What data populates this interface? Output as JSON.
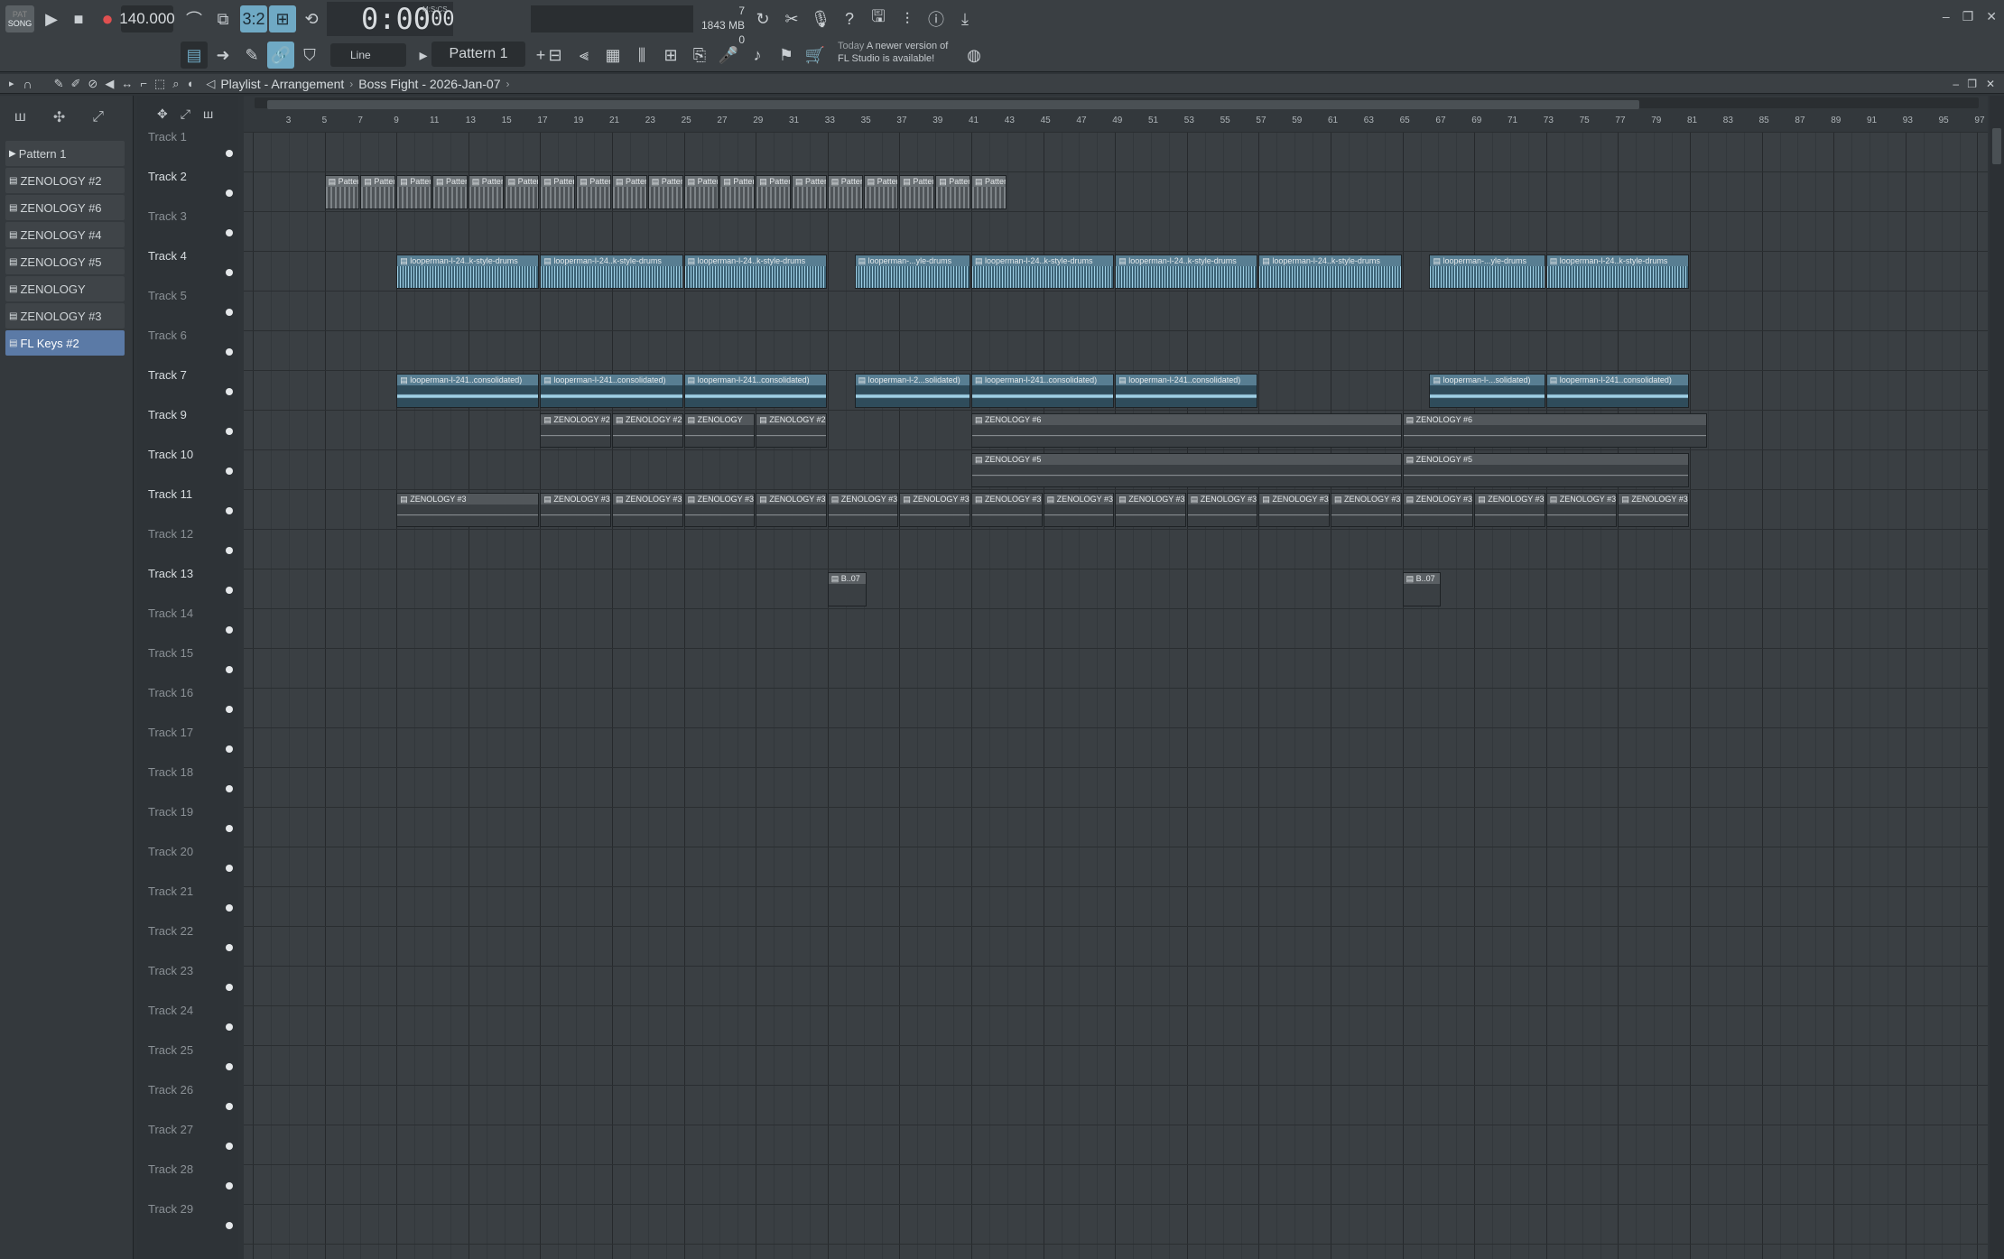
{
  "toolbar": {
    "mode_top": "SONG",
    "mode_bottom": "PAT",
    "tempo": "140.000",
    "time_main": "0:00",
    "time_sub": "00",
    "time_format": "M:S:CS",
    "cpu_value": "7",
    "memory": "1843 MB",
    "voices": "0",
    "snap": "Line",
    "pattern": "Pattern 1",
    "news_label": "Today",
    "news_text": "A newer version of",
    "news_text2": "FL Studio is available!"
  },
  "playlist": {
    "title": "Playlist - Arrangement",
    "project": "Boss Fight - 2026-Jan-07"
  },
  "picker": {
    "items": [
      {
        "label": "Pattern 1",
        "selected": false
      },
      {
        "label": "ZENOLOGY #2",
        "selected": false
      },
      {
        "label": "ZENOLOGY #6",
        "selected": false
      },
      {
        "label": "ZENOLOGY #4",
        "selected": false
      },
      {
        "label": "ZENOLOGY #5",
        "selected": false
      },
      {
        "label": "ZENOLOGY",
        "selected": false
      },
      {
        "label": "ZENOLOGY #3",
        "selected": false
      },
      {
        "label": "FL Keys #2",
        "selected": true
      }
    ]
  },
  "tracks": [
    {
      "name": "Track 1",
      "active": false
    },
    {
      "name": "Track 2",
      "active": true
    },
    {
      "name": "Track 3",
      "active": false
    },
    {
      "name": "Track 4",
      "active": true
    },
    {
      "name": "Track 5",
      "active": false
    },
    {
      "name": "Track 6",
      "active": false
    },
    {
      "name": "Track 7",
      "active": true
    },
    {
      "name": "Track 9",
      "active": true
    },
    {
      "name": "Track 10",
      "active": true
    },
    {
      "name": "Track 11",
      "active": true
    },
    {
      "name": "Track 12",
      "active": false
    },
    {
      "name": "Track 13",
      "active": true
    },
    {
      "name": "Track 14",
      "active": false
    },
    {
      "name": "Track 15",
      "active": false
    },
    {
      "name": "Track 16",
      "active": false
    },
    {
      "name": "Track 17",
      "active": false
    },
    {
      "name": "Track 18",
      "active": false
    },
    {
      "name": "Track 19",
      "active": false
    },
    {
      "name": "Track 20",
      "active": false
    },
    {
      "name": "Track 21",
      "active": false
    },
    {
      "name": "Track 22",
      "active": false
    },
    {
      "name": "Track 23",
      "active": false
    },
    {
      "name": "Track 24",
      "active": false
    },
    {
      "name": "Track 25",
      "active": false
    },
    {
      "name": "Track 26",
      "active": false
    },
    {
      "name": "Track 27",
      "active": false
    },
    {
      "name": "Track 28",
      "active": false
    },
    {
      "name": "Track 29",
      "active": false
    }
  ],
  "ruler": {
    "bars": [
      "3",
      "5",
      "7",
      "9",
      "11",
      "13",
      "15",
      "17",
      "19",
      "21",
      "23",
      "25",
      "27",
      "29",
      "31",
      "33",
      "35",
      "37",
      "39",
      "41",
      "43",
      "45",
      "47",
      "49",
      "51",
      "53",
      "55",
      "57",
      "59",
      "61",
      "63",
      "65",
      "67",
      "69",
      "71",
      "73",
      "75",
      "77",
      "79",
      "81",
      "83",
      "85",
      "87",
      "89",
      "91",
      "93",
      "95",
      "97"
    ]
  },
  "clips": [
    {
      "track": 1,
      "kind": "pattern",
      "label": "Pattern 1",
      "start": 5,
      "bars": 2,
      "count": 19
    },
    {
      "track": 3,
      "kind": "audio",
      "label": "looperman-l-24..k-style-drums",
      "start": 9,
      "bars": 8,
      "count": 3
    },
    {
      "track": 3,
      "kind": "audio",
      "label": "looperman-...yle-drums",
      "start": 34.5,
      "bars": 6.5,
      "count": 1
    },
    {
      "track": 3,
      "kind": "audio",
      "label": "looperman-l-24..k-style-drums",
      "start": 41,
      "bars": 8,
      "count": 3
    },
    {
      "track": 3,
      "kind": "audio",
      "label": "looperman-l-24..k-style-drums",
      "start": 57,
      "bars": 8,
      "count": 1
    },
    {
      "track": 3,
      "kind": "audio",
      "label": "looperman-...yle-drums",
      "start": 66.5,
      "bars": 6.5,
      "count": 1
    },
    {
      "track": 3,
      "kind": "audio",
      "label": "looperman-l-24..k-style-drums",
      "start": 73,
      "bars": 8,
      "count": 1
    },
    {
      "track": 6,
      "kind": "audio2",
      "label": "looperman-l-241..consolidated)",
      "start": 9,
      "bars": 8,
      "count": 3
    },
    {
      "track": 6,
      "kind": "audio2",
      "label": "looperman-l-2...solidated)",
      "start": 34.5,
      "bars": 6.5,
      "count": 1
    },
    {
      "track": 6,
      "kind": "audio2",
      "label": "looperman-l-241..consolidated)",
      "start": 41,
      "bars": 8,
      "count": 2
    },
    {
      "track": 6,
      "kind": "audio2",
      "label": "looperman-l-...solidated)",
      "start": 66.5,
      "bars": 6.5,
      "count": 1
    },
    {
      "track": 6,
      "kind": "audio2",
      "label": "looperman-l-241..consolidated)",
      "start": 73,
      "bars": 8,
      "count": 1
    },
    {
      "track": 7,
      "kind": "zen",
      "label": "ZENOLOGY #2",
      "start": 17,
      "bars": 4,
      "count": 2
    },
    {
      "track": 7,
      "kind": "zen",
      "label": "ZENOLOGY",
      "start": 25,
      "bars": 4,
      "count": 1
    },
    {
      "track": 7,
      "kind": "zen",
      "label": "ZENOLOGY #2",
      "start": 29,
      "bars": 4,
      "count": 1
    },
    {
      "track": 7,
      "kind": "zen",
      "label": "ZENOLOGY #6",
      "start": 41,
      "bars": 24,
      "count": 1
    },
    {
      "track": 7,
      "kind": "zen",
      "label": "ZENOLOGY #6",
      "start": 65,
      "bars": 17,
      "count": 1
    },
    {
      "track": 8,
      "kind": "zen",
      "label": "ZENOLOGY #5",
      "start": 41,
      "bars": 24,
      "count": 1
    },
    {
      "track": 8,
      "kind": "zen",
      "label": "ZENOLOGY #5",
      "start": 65,
      "bars": 16,
      "count": 1
    },
    {
      "track": 9,
      "kind": "zen",
      "label": "ZENOLOGY #3",
      "start": 9,
      "bars": 8,
      "count": 1
    },
    {
      "track": 9,
      "kind": "zen",
      "label": "ZENOLOGY #3",
      "start": 17,
      "bars": 4,
      "count": 16
    },
    {
      "track": 11,
      "kind": "beat",
      "label": "B..07",
      "start": 33,
      "bars": 2.2,
      "count": 1
    },
    {
      "track": 11,
      "kind": "beat",
      "label": "B..07",
      "start": 65,
      "bars": 2.2,
      "count": 1
    }
  ],
  "colors": {
    "accent": "#6fa9c4",
    "selected": "#5b7aa6",
    "audio": "#9fd0e6"
  }
}
